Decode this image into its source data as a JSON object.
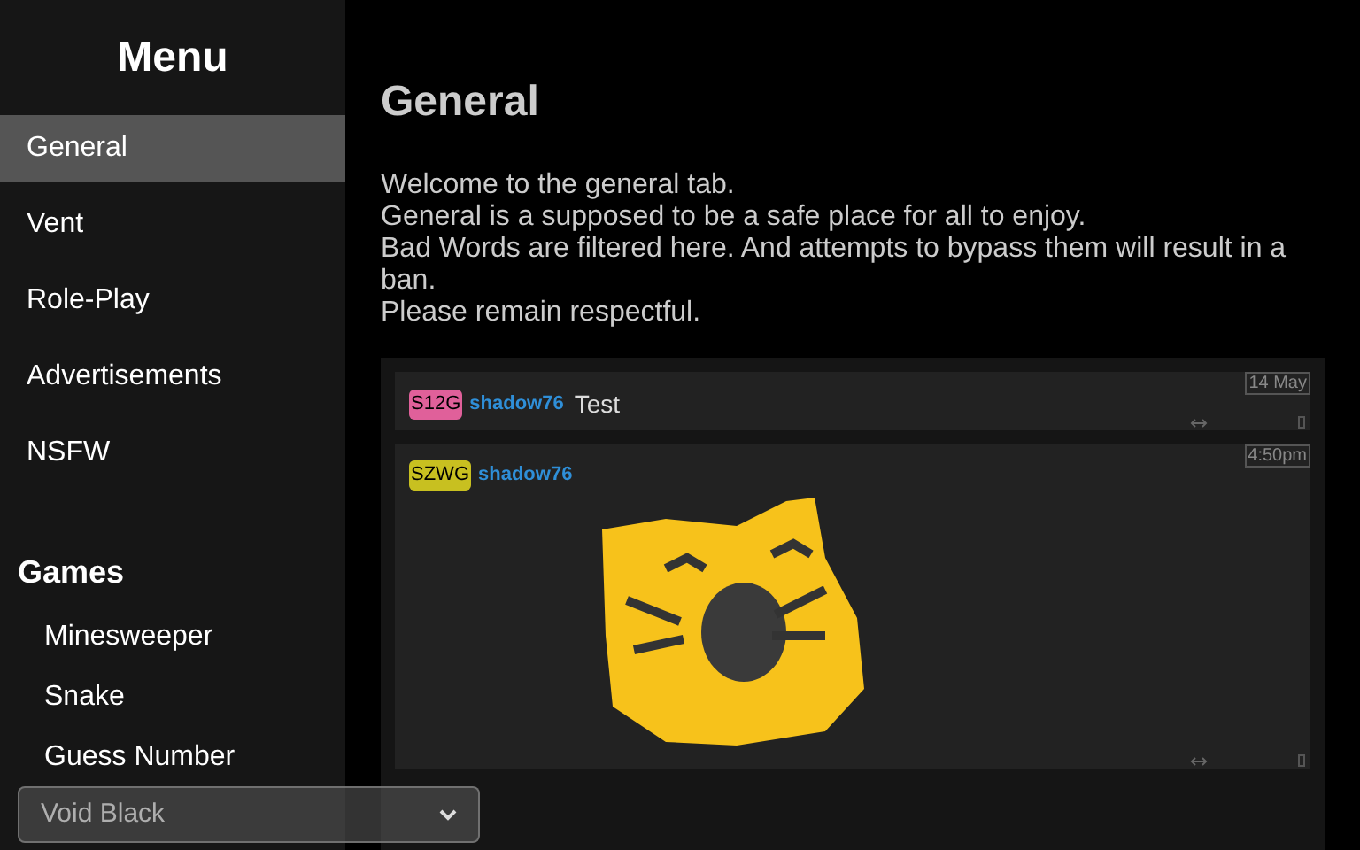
{
  "sidebar": {
    "title": "Menu",
    "items": [
      {
        "label": "General",
        "selected": true
      },
      {
        "label": "Vent",
        "selected": false
      },
      {
        "label": "Role-Play",
        "selected": false
      },
      {
        "label": "Advertisements",
        "selected": false
      },
      {
        "label": "NSFW",
        "selected": false
      }
    ],
    "games": {
      "title": "Games",
      "items": [
        {
          "label": "Minesweeper"
        },
        {
          "label": "Snake"
        },
        {
          "label": "Guess Number"
        }
      ]
    },
    "theme_select": {
      "value": "Void Black"
    }
  },
  "main": {
    "title": "General",
    "description": [
      "Welcome to the general tab.",
      "General is a supposed to be a safe place for all to enjoy.",
      "Bad Words are filtered here. And attempts to bypass them will result in a ban.",
      "Please remain respectful."
    ],
    "messages": [
      {
        "kind": "text",
        "tag": "S12G",
        "color": "#e0609a",
        "user": "shadow76",
        "text": "Test",
        "time": "14 May"
      },
      {
        "kind": "image",
        "tag": "SZWG",
        "color": "#c8c020",
        "user": "shadow76",
        "time": "4:50pm"
      }
    ]
  }
}
